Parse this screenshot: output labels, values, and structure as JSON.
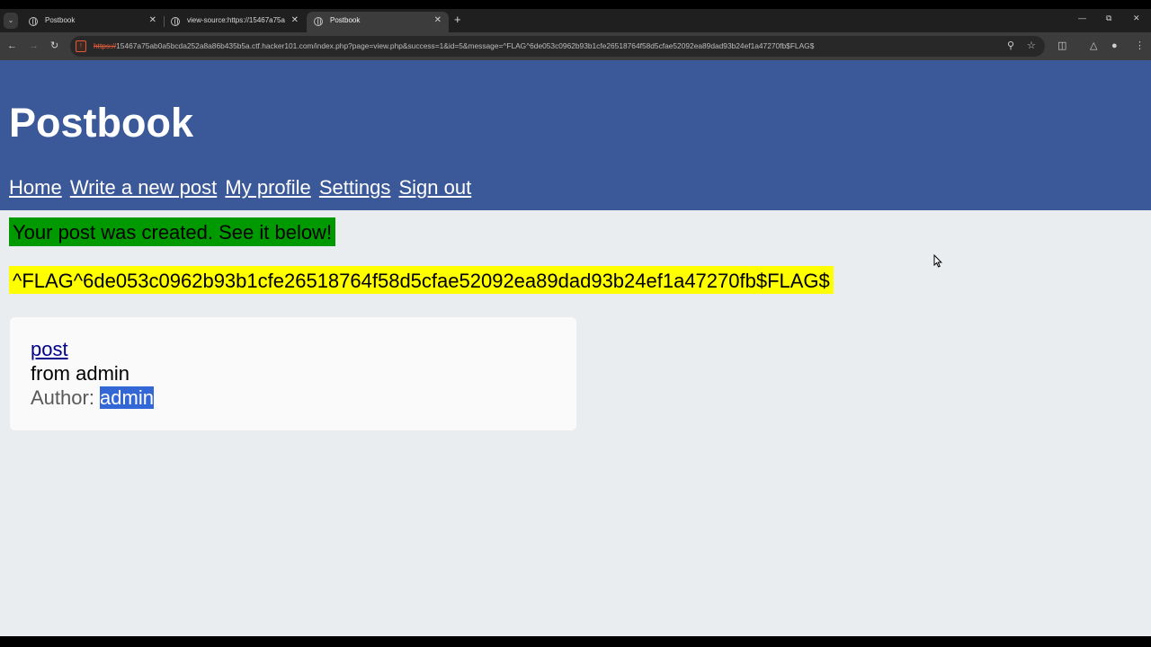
{
  "browser": {
    "tabs": [
      {
        "title": "Postbook",
        "active": false
      },
      {
        "title": "view-source:https://15467a75a",
        "active": false
      },
      {
        "title": "Postbook",
        "active": true
      }
    ],
    "new_tab": "+",
    "url_scheme": "https://",
    "url_rest": "15467a75ab0a5bcda252a8a86b435b5a.ctf.hacker101.com/index.php?page=view.php&success=1&id=5&message=^FLAG^6de053c0962b93b1cfe26518764f58d5cfae52092ea89dad93b24ef1a47270fb$FLAG$"
  },
  "site": {
    "title": "Postbook",
    "nav": [
      "Home",
      "Write a new post",
      "My profile",
      "Settings",
      "Sign out"
    ]
  },
  "messages": {
    "success": "Your post was created. See it below!",
    "flag": "^FLAG^6de053c0962b93b1cfe26518764f58d5cfae52092ea89dad93b24ef1a47270fb$FLAG$"
  },
  "post": {
    "title": "post",
    "body": "from admin",
    "author_label": "Author: ",
    "author": "admin"
  },
  "colors": {
    "header_bg": "#3b5998",
    "page_bg": "#e9edf0",
    "success_bg": "#009a00",
    "flag_bg": "#ffff00",
    "link": "#00008b",
    "selection": "#3367d6"
  }
}
